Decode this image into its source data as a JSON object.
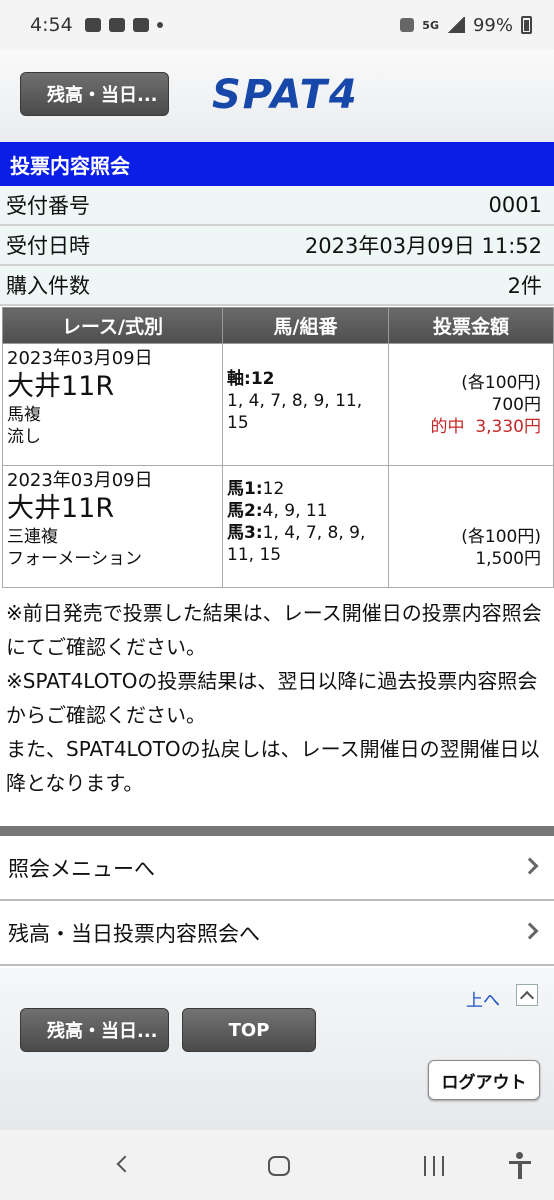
{
  "status_bar": {
    "time": "4:54",
    "network": "5G",
    "battery": "99%"
  },
  "header": {
    "back_label": "残高・当日...",
    "logo": "SPAT4"
  },
  "section_title": "投票内容照会",
  "info": [
    {
      "label": "受付番号",
      "value": "0001"
    },
    {
      "label": "受付日時",
      "value": "2023年03月09日 11:52"
    },
    {
      "label": "購入件数",
      "value": "2件"
    }
  ],
  "table": {
    "headers": [
      "レース/式別",
      "馬/組番",
      "投票金額"
    ],
    "rows": [
      {
        "date": "2023年03月09日",
        "race": "大井11R",
        "type": "馬複",
        "method": "流し",
        "combo": [
          {
            "key": "軸:",
            "val": "12"
          },
          {
            "key": "",
            "val": "1, 4, 7, 8, 9, 11,"
          },
          {
            "key": "",
            "val": "15"
          }
        ],
        "unit": "(各100円)",
        "amount": "700円",
        "hit_label": "的中",
        "hit_amount": "3,330円"
      },
      {
        "date": "2023年03月09日",
        "race": "大井11R",
        "type": "三連複",
        "method": "フォーメーション",
        "combo": [
          {
            "key": "馬1:",
            "val": "12"
          },
          {
            "key": "馬2:",
            "val": "4, 9, 11"
          },
          {
            "key": "馬3:",
            "val": "1, 4, 7, 8, 9,"
          },
          {
            "key": "",
            "val": "11, 15"
          }
        ],
        "unit": "(各100円)",
        "amount": "1,500円"
      }
    ]
  },
  "notes": [
    "※前日発売で投票した結果は、レース開催日の投票内容照会にてご確認ください。",
    "※SPAT4LOTOの投票結果は、翌日以降に過去投票内容照会からご確認ください。",
    "また、SPAT4LOTOの払戻しは、レース開催日の翌開催日以降となります。"
  ],
  "menu": [
    {
      "label": "照会メニューへ"
    },
    {
      "label": "残高・当日投票内容照会へ"
    }
  ],
  "footer": {
    "top_link": "上へ",
    "back_label": "残高・当日...",
    "top_button": "TOP",
    "logout": "ログアウト"
  }
}
